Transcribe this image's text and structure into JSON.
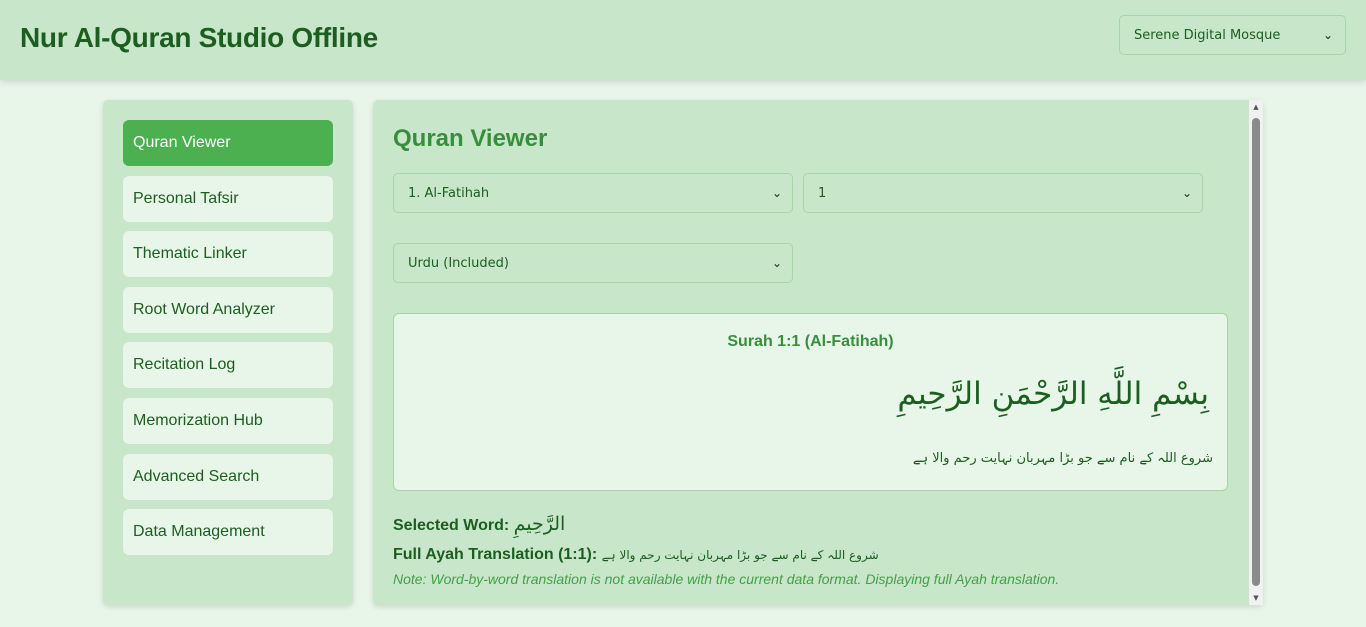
{
  "app": {
    "title": "Nur Al-Quran Studio Offline",
    "theme_select": {
      "value": "Serene Digital Mosque",
      "icon": "chevron-down-icon"
    }
  },
  "sidebar": {
    "items": [
      {
        "label": "Quran Viewer",
        "active": true
      },
      {
        "label": "Personal Tafsir"
      },
      {
        "label": "Thematic Linker"
      },
      {
        "label": "Root Word Analyzer"
      },
      {
        "label": "Recitation Log"
      },
      {
        "label": "Memorization Hub"
      },
      {
        "label": "Advanced Search"
      },
      {
        "label": "Data Management"
      }
    ]
  },
  "main": {
    "title": "Quran Viewer",
    "surah_select": {
      "value": "1. Al-Fatihah"
    },
    "ayah_select": {
      "value": "1"
    },
    "translation_select": {
      "value": "Urdu (Included)"
    },
    "ayah_card": {
      "reference": "Surah 1:1 (Al-Fatihah)",
      "arabic": "بِسْمِ اللَّهِ الرَّحْمَنِ الرَّحِيمِ",
      "translation": "شروع اللہ کے نام سے جو بڑا مہربان نہایت رحم والا ہے"
    },
    "selected_word": {
      "label": "Selected Word:",
      "value": "الرَّحِيمِ"
    },
    "full_translation": {
      "label": "Full Ayah Translation (1:1):",
      "value": "شروع اللہ کے نام سے جو بڑا مہربان نہایت رحم والا ہے"
    },
    "note": "Note: Word-by-word translation is not available with the current data format. Displaying full Ayah translation."
  },
  "colors": {
    "header_bg": "#c8e6c9",
    "page_bg": "#e8f5e9",
    "active_nav": "#4caf50",
    "title_green": "#1b5e20",
    "accent_green": "#388e3c"
  }
}
